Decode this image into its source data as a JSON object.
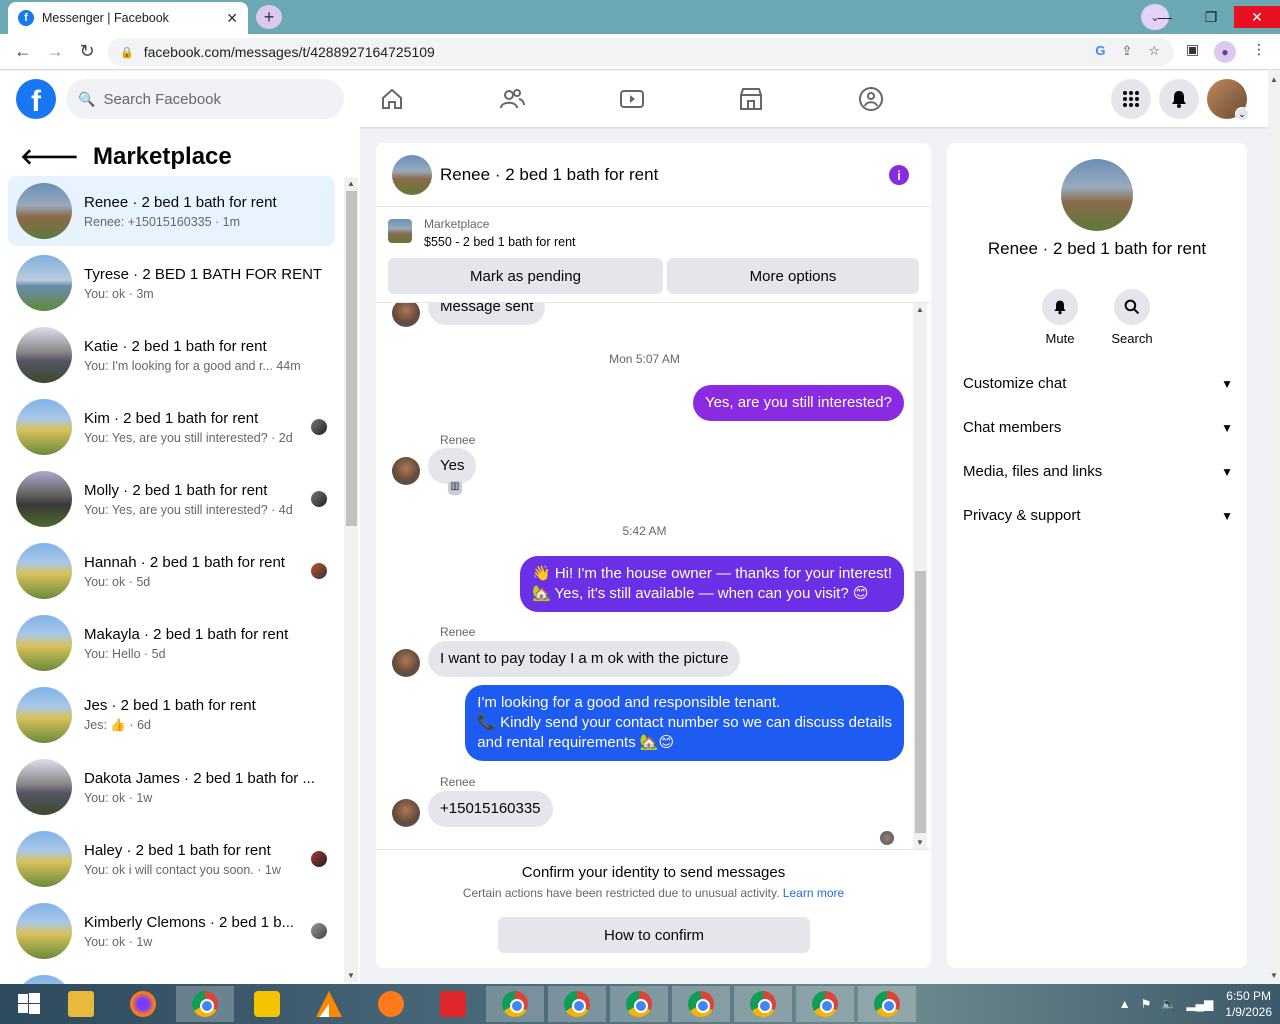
{
  "browser": {
    "tab_title": "Messenger | Facebook",
    "url": "facebook.com/messages/t/4288927164725109"
  },
  "header": {
    "search_placeholder": "Search Facebook"
  },
  "sidebar": {
    "title": "Marketplace",
    "conversations": [
      {
        "name": "Renee · 2 bed 1 bath for rent",
        "preview": "Renee: +15015160335 · 1m",
        "active": true
      },
      {
        "name": "Tyrese · 2 BED 1 BATH FOR RENT",
        "preview": "You: ok · 3m"
      },
      {
        "name": "Katie · 2 bed 1 bath for rent",
        "preview": "You: I'm looking for a good and r...  44m"
      },
      {
        "name": "Kim · 2 bed 1 bath for rent",
        "preview": "You: Yes, are you still interested? · 2d"
      },
      {
        "name": "Molly · 2 bed 1 bath for rent",
        "preview": "You: Yes, are you still interested? · 4d"
      },
      {
        "name": "Hannah · 2 bed 1 bath for rent",
        "preview": "You: ok · 5d"
      },
      {
        "name": "Makayla · 2 bed 1 bath for rent",
        "preview": "You: Hello · 5d"
      },
      {
        "name": "Jes · 2 bed 1 bath for rent",
        "preview": "Jes: 👍 · 6d"
      },
      {
        "name": "Dakota James · 2 bed 1 bath for ...",
        "preview": "You: ok · 1w"
      },
      {
        "name": "Haley · 2 bed 1 bath for rent",
        "preview": "You: ok i will contact you soon. · 1w"
      },
      {
        "name": "Kimberly Clemons · 2 bed 1 b...",
        "preview": "You: ok · 1w"
      }
    ]
  },
  "chat": {
    "title": "Renee · 2 bed 1 bath for rent",
    "marketplace_label": "Marketplace",
    "listing": "$550 - 2 bed 1 bath for rent",
    "mark_pending": "Mark as pending",
    "more_options": "More options",
    "msg_sent": "Message sent",
    "ts1": "Mon 5:07 AM",
    "out1": "Yes, are you still interested?",
    "sender": "Renee",
    "in1": "Yes",
    "ts2": "5:42 AM",
    "out2_line1": "👋 Hi! I'm the house owner — thanks for your interest!",
    "out2_line2": "🏡 Yes, it's still available — when can you visit? 😊",
    "in2": "I want to pay today I a m ok with the picture",
    "out3_line1": "I'm looking for a good and responsible tenant.",
    "out3_line2": "📞 Kindly send your contact number so we can discuss details",
    "out3_line3": "and rental requirements 🏡😊",
    "in3": "+15015160335",
    "confirm_title": "Confirm your identity to send messages",
    "confirm_sub": "Certain actions have been restricted due to unusual activity.",
    "learn_more": "Learn more",
    "how_to_confirm": "How to confirm"
  },
  "right_panel": {
    "name": "Renee · 2 bed 1 bath for rent",
    "mute": "Mute",
    "search": "Search",
    "sections": [
      "Customize chat",
      "Chat members",
      "Media, files and links",
      "Privacy & support"
    ]
  },
  "taskbar": {
    "time": "6:50 PM",
    "date": "1/9/2026"
  },
  "colors": {
    "fb_blue": "#1877f2",
    "bubble_purple": "#8a2be2",
    "bubble_violet": "#6b2fe6",
    "bubble_blue": "#1e5bf0"
  }
}
